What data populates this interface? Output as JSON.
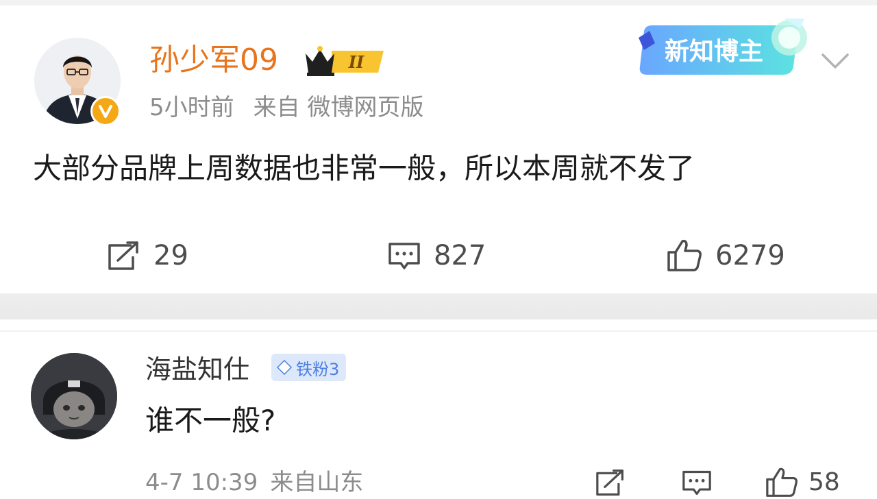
{
  "post": {
    "username": "孙少军09",
    "level_badge": "II",
    "time": "5小时前",
    "source": "来自 微博网页版",
    "badge_text": "新知博主",
    "text": "大部分品牌上周数据也非常一般，所以本周就不发了",
    "reposts": "29",
    "comments": "827",
    "likes": "6279"
  },
  "comment": {
    "username": "海盐知仕",
    "fan_badge": "铁粉3",
    "text": "谁不一般?",
    "time": "4-7 10:39",
    "location": "来自山东",
    "likes": "58"
  },
  "icons": {
    "verified": "verified-v-icon",
    "crown": "crown-level-icon",
    "more": "chevron-down-icon",
    "repost": "repost-icon",
    "comment": "comment-icon",
    "like": "thumbs-up-icon",
    "fan": "diamond-icon"
  },
  "colors": {
    "username": "#e8741b",
    "verified": "#f4a816",
    "badge_blue": "#4a7fe0"
  }
}
